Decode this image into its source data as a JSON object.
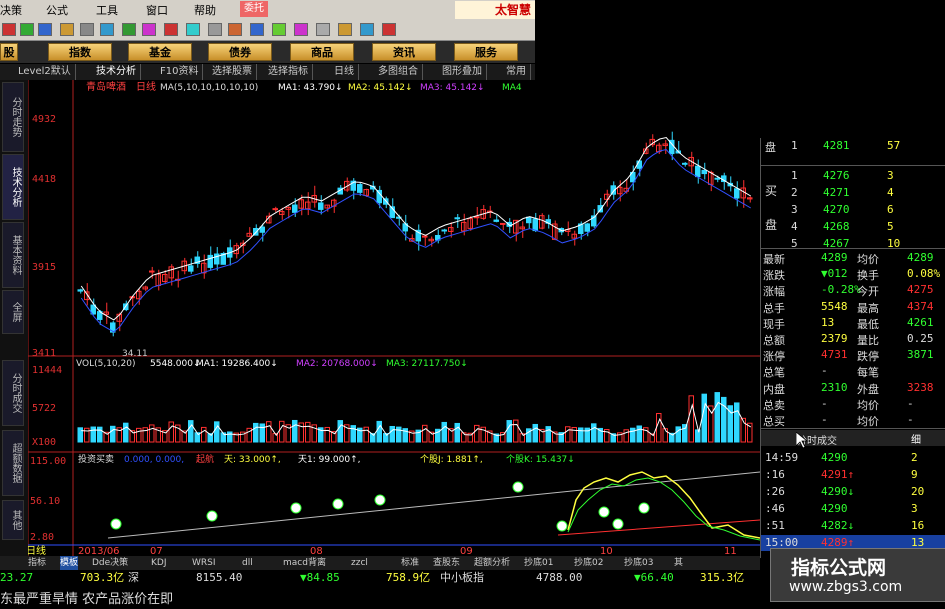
{
  "menu": {
    "items": [
      "决策",
      "公式",
      "工具",
      "窗口",
      "帮助"
    ],
    "dropdown": "委托",
    "brand": "太智慧"
  },
  "nav": [
    "股",
    "指数",
    "基金",
    "债券",
    "商品",
    "资讯",
    "服务"
  ],
  "tabs2": [
    "Level2默认",
    "技术分析",
    "F10资料",
    "选择股票",
    "选择指标",
    "日线",
    "多图组合",
    "图形叠加",
    "常用"
  ],
  "left_tabs": [
    "分时走势",
    "技术分析",
    "基本资料",
    "全屏",
    "分时成交",
    "超额数据",
    "其他"
  ],
  "price_chart": {
    "title": "青岛啤酒",
    "period": "日线",
    "ma_label": "MA(5,10,10,10,10,10)",
    "ma1": "MA1: 43.790↓",
    "ma2": "MA2: 45.142↓",
    "ma3": "MA3: 45.142↓",
    "ma4": "MA4",
    "y_ticks": [
      "4932",
      "4418",
      "3915",
      "3411"
    ],
    "low_label": "34.11"
  },
  "vol_chart": {
    "label": "VOL(5,10,20)",
    "value": "5548.000↓",
    "ma1": "MA1: 19286.400↓",
    "ma2": "MA2: 20768.000↓",
    "ma3": "MA3: 27117.750↓",
    "y_ticks": [
      "11444",
      "5722",
      "X100"
    ]
  },
  "ind_chart": {
    "label": "投资买卖",
    "vals": "0.000, 0.000,",
    "qidian": "起航",
    "tian": "天: 33.000↑,",
    "tian1": "天1: 99.000↑,",
    "gegu_j": "个股J: 1.881↑,",
    "gegu_k": "个股K: 15.437↓",
    "y_ticks": [
      "115.00",
      "56.10",
      "2.80"
    ],
    "date_label": "日线",
    "date1": "2013/06",
    "date2": "07",
    "date3": "08",
    "date4": "09",
    "date5": "10",
    "date6": "11"
  },
  "quote": {
    "sell_label": "盘",
    "buy_label1": "买",
    "buy_label2": "盘",
    "sell_rows": [
      {
        "lv": "1",
        "price": "4281",
        "vol": "57"
      }
    ],
    "buy_rows": [
      {
        "lv": "1",
        "price": "4276",
        "vol": "3"
      },
      {
        "lv": "2",
        "price": "4271",
        "vol": "4"
      },
      {
        "lv": "3",
        "price": "4270",
        "vol": "6"
      },
      {
        "lv": "4",
        "price": "4268",
        "vol": "5"
      },
      {
        "lv": "5",
        "price": "4267",
        "vol": "10"
      }
    ],
    "stats": [
      {
        "k1": "最新",
        "v1": "4289",
        "k2": "均价",
        "v2": "4289"
      },
      {
        "k1": "涨跌",
        "v1": "▼012",
        "k2": "换手",
        "v2": "0.08%"
      },
      {
        "k1": "涨幅",
        "v1": "-0.28%",
        "k2": "今开",
        "v2": "4275"
      },
      {
        "k1": "总手",
        "v1": "5548",
        "k2": "最高",
        "v2": "4374"
      },
      {
        "k1": "现手",
        "v1": "13",
        "k2": "最低",
        "v2": "4261"
      },
      {
        "k1": "总额",
        "v1": "2379",
        "k2": "量比",
        "v2": "0.25"
      },
      {
        "k1": "涨停",
        "v1": "4731",
        "k2": "跌停",
        "v2": "3871"
      },
      {
        "k1": "总笔",
        "v1": "-",
        "k2": "每笔",
        "v2": ""
      },
      {
        "k1": "内盘",
        "v1": "2310",
        "k2": "外盘",
        "v2": "3238"
      },
      {
        "k1": "总卖",
        "v1": "-",
        "k2": "均价",
        "v2": "-"
      },
      {
        "k1": "总买",
        "v1": "-",
        "k2": "均价",
        "v2": "-"
      }
    ],
    "ticks_header": "分时成交",
    "ticks_tab": "细",
    "ticks": [
      {
        "t": "14:59",
        "p": "4290",
        "v": "2"
      },
      {
        "t": ":16",
        "p": "4291↑",
        "v": "9"
      },
      {
        "t": ":26",
        "p": "4290↓",
        "v": "20"
      },
      {
        "t": ":46",
        "p": "4290",
        "v": "3"
      },
      {
        "t": ":51",
        "p": "4282↓",
        "v": "16"
      },
      {
        "t": "15:00",
        "p": "4289↑",
        "v": "13"
      }
    ]
  },
  "bottom_tabs": [
    "指标",
    "模板",
    "Dde决策",
    "KDJ",
    "WRSI",
    "dll",
    "macd背离",
    "zzcl",
    "标准",
    "查股东",
    "超额分析",
    "抄底01",
    "抄底02",
    "抄底03",
    "其"
  ],
  "status": {
    "s1": "23.27",
    "s2": "703.3亿",
    "s3": "深",
    "s4": "8155.40",
    "s5": "▼84.85",
    "s6": "758.9亿",
    "s7": "中小板指",
    "s8": "4788.00",
    "s9": "▼66.40",
    "s10": "315.3亿"
  },
  "news": "东最严重旱情 农产品涨价在即",
  "watermark": {
    "line1": "指标公式网",
    "line2": "www.zbgs3.com"
  },
  "colors": {
    "up": "#ff3030",
    "down": "#30d8ff",
    "ma_white": "#ffffff",
    "ma_yellow": "#ffff40",
    "ma_purple": "#d040ff",
    "ma_green": "#30ff30",
    "axis_red": "#b02020"
  }
}
